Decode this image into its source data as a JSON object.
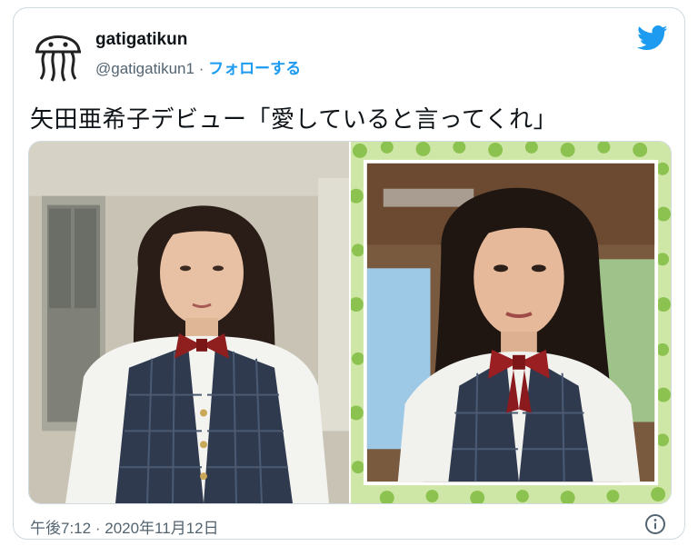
{
  "tweet": {
    "display_name": "gatigatikun",
    "handle": "@gatigatikun1",
    "separator": "·",
    "follow_label": "フォローする",
    "text": "矢田亜希子デビュー「愛していると言ってくれ」",
    "time": "午後7:12",
    "date": "2020年11月12日",
    "timestamp_separator": "·"
  },
  "icons": {
    "avatar": "jellyfish-icon",
    "brand": "twitter-bird-icon",
    "info": "info-icon"
  },
  "colors": {
    "accent": "#1d9bf0",
    "secondary_text": "#536471",
    "border": "#cfd9de"
  }
}
